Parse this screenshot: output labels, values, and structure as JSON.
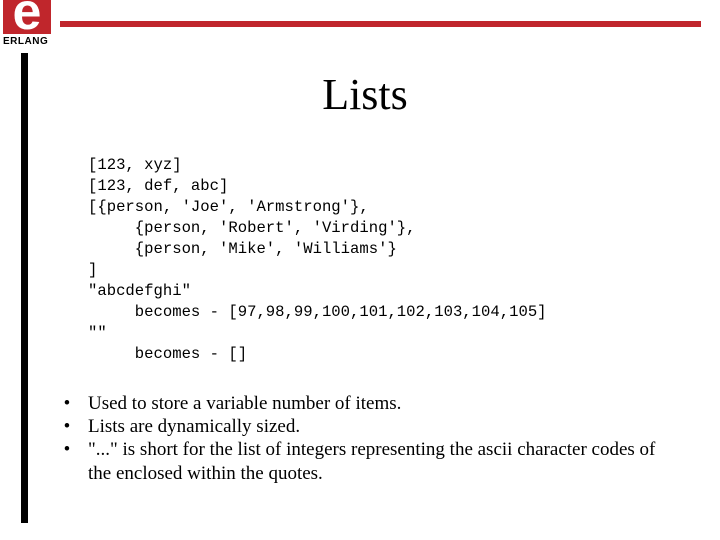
{
  "logo": {
    "glyph": "e",
    "text": "ERLANG"
  },
  "colors": {
    "brand_red": "#c0262c",
    "side_bar": "#000000"
  },
  "slide": {
    "title": "Lists",
    "code_lines": [
      "[123, xyz]",
      "[123, def, abc]",
      "[{person, 'Joe', 'Armstrong'},",
      "     {person, 'Robert', 'Virding'},",
      "     {person, 'Mike', 'Williams'}",
      "]",
      "\"abcdefghi\"",
      "     becomes - [97,98,99,100,101,102,103,104,105]",
      "\"\"",
      "     becomes - []"
    ],
    "bullet_glyph": "•",
    "bullets": [
      "Used to store a variable number of items.",
      "Lists are dynamically sized.",
      "\"...\" is short for the list of integers representing the ascii character codes of the enclosed within the quotes."
    ]
  }
}
